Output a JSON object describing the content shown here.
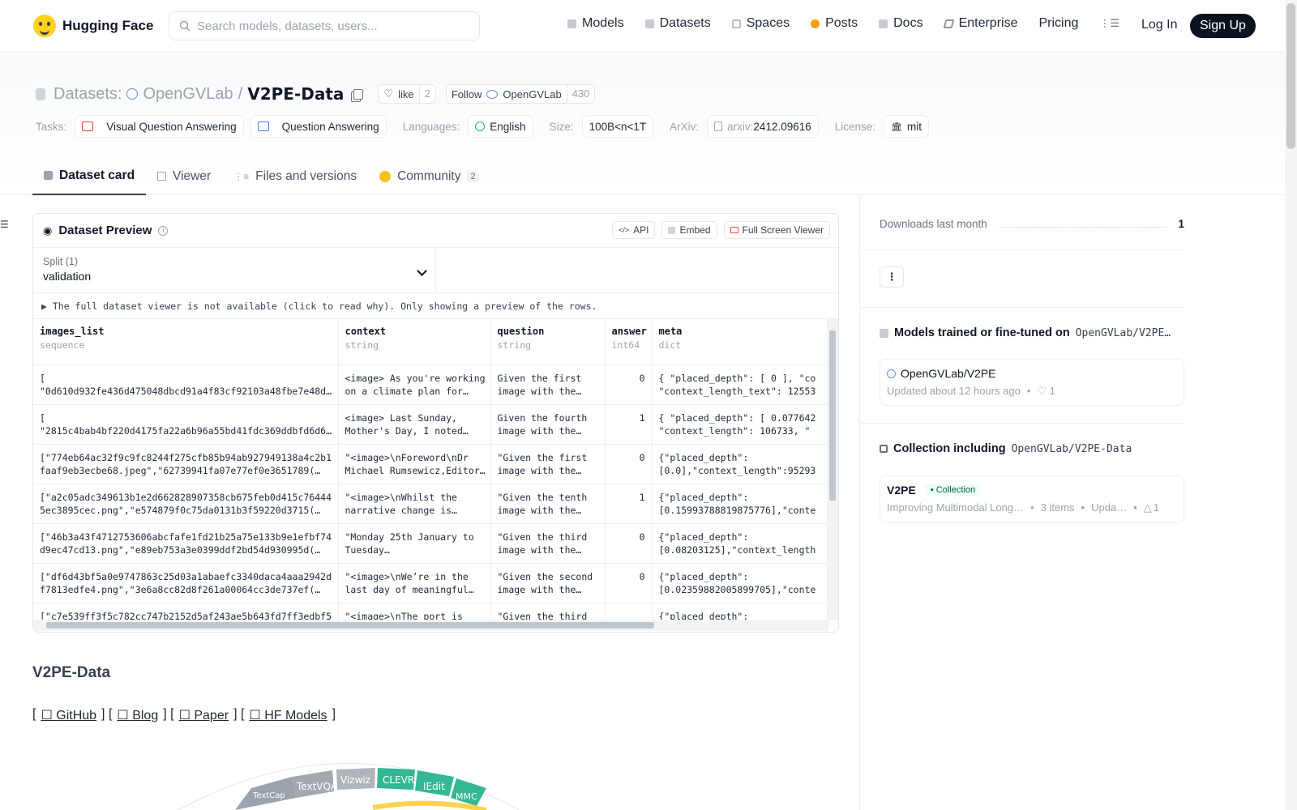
{
  "nav": {
    "brand": "Hugging Face",
    "search_placeholder": "Search models, datasets, users...",
    "links": [
      "Models",
      "Datasets",
      "Spaces",
      "Posts",
      "Docs",
      "Enterprise",
      "Pricing"
    ],
    "login": "Log In",
    "signup": "Sign Up"
  },
  "header": {
    "section": "Datasets:",
    "org": "OpenGVLab",
    "slash": "/",
    "name": "V2PE-Data",
    "like_label": "like",
    "like_count": "2",
    "follow_label": "Follow",
    "follow_org": "OpenGVLab",
    "follow_count": "430",
    "tasks_label": "Tasks:",
    "tasks": [
      "Visual Question Answering",
      "Question Answering"
    ],
    "languages_label": "Languages:",
    "language": "English",
    "size_label": "Size:",
    "size": "100B<n<1T",
    "arxiv_label": "ArXiv:",
    "arxiv_prefix": "arxiv:",
    "arxiv_id": "2412.09616",
    "license_label": "License:",
    "license": "mit"
  },
  "tabs": [
    {
      "label": "Dataset card"
    },
    {
      "label": "Viewer"
    },
    {
      "label": "Files and versions"
    },
    {
      "label": "Community",
      "badge": "2"
    }
  ],
  "preview": {
    "title": "Dataset Preview",
    "api": "API",
    "embed": "Embed",
    "fullscreen": "Full Screen Viewer",
    "split_label": "Split (1)",
    "split_value": "validation",
    "notice": "▶ The full dataset viewer is not available (click to read why). Only showing a preview of the rows.",
    "columns": [
      {
        "name": "images_list",
        "type": "sequence"
      },
      {
        "name": "context",
        "type": "string"
      },
      {
        "name": "question",
        "type": "string"
      },
      {
        "name": "answer",
        "type": "int64"
      },
      {
        "name": "meta",
        "type": "dict"
      }
    ],
    "rows": [
      {
        "images": "[\n\"0d610d932fe436d475048dbcd91a4f83cf92103a48fbe7e48d…",
        "context": "<image> As you're working\non a climate plan for…",
        "question": "Given the first\nimage with the…",
        "answer": "0",
        "meta": "{ \"placed_depth\": [ 0 ], \"co\n\"context_length_text\": 12553"
      },
      {
        "images": "[\n\"2815c4bab4bf220d4175fa22a6b96a55bd41fdc369ddbfd6d6…",
        "context": "<image> Last Sunday,\nMother's Day, I noted…",
        "question": "Given the fourth\nimage with the…",
        "answer": "1",
        "meta": "{ \"placed_depth\": [ 0.077642\n\"context_length\": 106733, \""
      },
      {
        "images": "[\"774eb64ac32f9c9fc8244f275cfb85b94ab927949138a4c2b1\nfaaf9eb3ecbe68.jpeg\",\"62739941fa07e77ef0e3651789(…",
        "context": "\"<image>\\nForeword\\nDr\nMichael Rumsewicz,Editor…",
        "question": "\"Given the first\nimage with the…",
        "answer": "0",
        "meta": "{\"placed_depth\":\n[0.0],\"context_length\":95293"
      },
      {
        "images": "[\"a2c05adc349613b1e2d662828907358cb675feb0d415c76444\n5ec3895cec.png\",\"e574879f0c75da0131b3f59220d3715(…",
        "context": "\"<image>\\nWhilst the\nnarrative change is…",
        "question": "\"Given the tenth\nimage with the…",
        "answer": "1",
        "meta": "{\"placed_depth\":\n[0.15993788819875776],\"conte"
      },
      {
        "images": "[\"46b3a43f4712753606abcfafe1fd21b25a75e133b9e1efbf74\nd9ec47cd13.png\",\"e89eb753a3e0399ddf2bd54d930995d(…",
        "context": "\"Monday 25th January to\nTuesday…",
        "question": "\"Given the third\nimage with the…",
        "answer": "0",
        "meta": "{\"placed_depth\":\n[0.08203125],\"context_length"
      },
      {
        "images": "[\"df6d43bf5a0e9747863c25d03a1abaefc3340daca4aaa2942d\nf7813edfe4.png\",\"3e6a8cc82d8f261a00064cc3de737ef(…",
        "context": "\"<image>\\nWe’re in the\nlast day of meaningful…",
        "question": "\"Given the second\nimage with the…",
        "answer": "0",
        "meta": "{\"placed_depth\":\n[0.02359882005899705],\"conte"
      },
      {
        "images": "[\"c7e539ff3f5c782cc747b2152d5af243ae5b643fd7ff3edbf5",
        "context": "\"<image>\\nThe port is",
        "question": "\"Given the third",
        "answer": "",
        "meta": "{\"placed_depth\":"
      }
    ]
  },
  "content": {
    "heading": "V2PE-Data",
    "links": [
      "GitHub",
      "Blog",
      "Paper",
      "HF Models"
    ],
    "wheel_labels": [
      "TextCap",
      "TextVQA",
      "Vizwiz",
      "CLEVR",
      "IEdit",
      "MMC"
    ]
  },
  "sidebar": {
    "downloads_label": "Downloads last month",
    "downloads_value": "1",
    "models_title": "Models trained or fine-tuned on",
    "models_repo": "OpenGVLab/V2PE…",
    "model_name": "OpenGVLab/V2PE",
    "model_updated": "Updated about 12 hours ago",
    "model_likes": "♡ 1",
    "collection_title": "Collection including",
    "collection_repo": "OpenGVLab/V2PE-Data",
    "collection_name": "V2PE",
    "collection_badge": "Collection",
    "collection_desc": "Improving Multimodal Long…",
    "collection_items": "3 items",
    "collection_updated": "Upda…",
    "collection_upvotes": "1"
  }
}
